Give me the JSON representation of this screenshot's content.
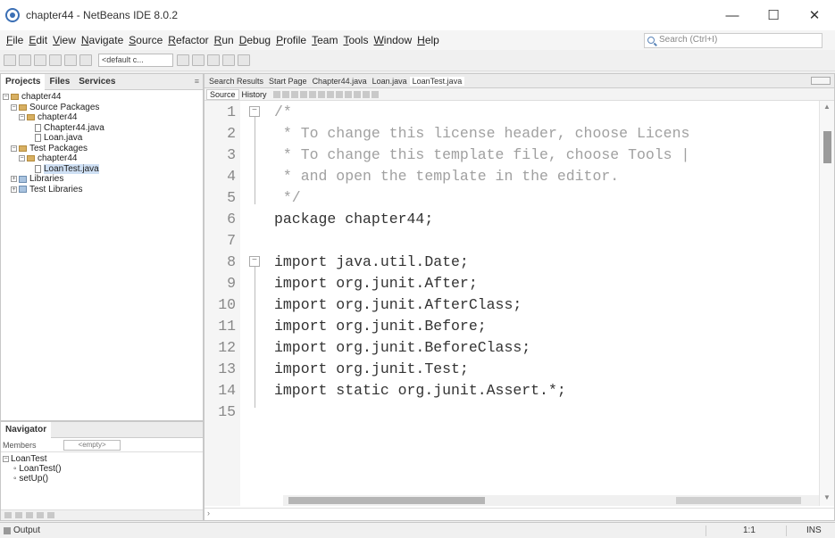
{
  "window": {
    "title": "chapter44 - NetBeans IDE 8.0.2",
    "controls": [
      "—",
      "☐",
      "✕"
    ]
  },
  "menubar": {
    "items": [
      "File",
      "Edit",
      "View",
      "Navigate",
      "Source",
      "Refactor",
      "Run",
      "Debug",
      "Profile",
      "Team",
      "Tools",
      "Window",
      "Help"
    ],
    "search_placeholder": "Search (Ctrl+I)"
  },
  "toolbar": {
    "config": "<default c..."
  },
  "projects": {
    "tabs": [
      "Projects",
      "Files",
      "Services"
    ],
    "tree": [
      {
        "label": "chapter44",
        "level": 0,
        "type": "project"
      },
      {
        "label": "Source Packages",
        "level": 1,
        "type": "folder"
      },
      {
        "label": "chapter44",
        "level": 2,
        "type": "package"
      },
      {
        "label": "Chapter44.java",
        "level": 3,
        "type": "file"
      },
      {
        "label": "Loan.java",
        "level": 3,
        "type": "file"
      },
      {
        "label": "Test Packages",
        "level": 1,
        "type": "folder"
      },
      {
        "label": "chapter44",
        "level": 2,
        "type": "package"
      },
      {
        "label": "LoanTest.java",
        "level": 3,
        "type": "file",
        "selected": true
      },
      {
        "label": "Libraries",
        "level": 1,
        "type": "lib"
      },
      {
        "label": "Test Libraries",
        "level": 1,
        "type": "lib"
      }
    ]
  },
  "navigator": {
    "title": "Navigator",
    "filter_label": "Members",
    "filter_value": "<empty>",
    "tree": [
      "LoanTest",
      "LoanTest()",
      "setUp()"
    ]
  },
  "editor": {
    "tabs": [
      "Search Results",
      "Start Page",
      "Chapter44.java",
      "Loan.java",
      "LoanTest.java"
    ],
    "active_tab": "LoanTest.java",
    "view_tabs": [
      "Source",
      "History"
    ],
    "lines": [
      {
        "n": "1",
        "text": "/*",
        "comment": true
      },
      {
        "n": "2",
        "text": " * To change this license header, choose Licens",
        "comment": true
      },
      {
        "n": "3",
        "text": " * To change this template file, choose Tools |",
        "comment": true
      },
      {
        "n": "4",
        "text": " * and open the template in the editor.",
        "comment": true
      },
      {
        "n": "5",
        "text": " */",
        "comment": true
      },
      {
        "n": "6",
        "text": "package chapter44;",
        "comment": false
      },
      {
        "n": "7",
        "text": "",
        "comment": false
      },
      {
        "n": "8",
        "text": "import java.util.Date;",
        "comment": false
      },
      {
        "n": "9",
        "text": "import org.junit.After;",
        "comment": false
      },
      {
        "n": "10",
        "text": "import org.junit.AfterClass;",
        "comment": false
      },
      {
        "n": "11",
        "text": "import org.junit.Before;",
        "comment": false
      },
      {
        "n": "12",
        "text": "import org.junit.BeforeClass;",
        "comment": false
      },
      {
        "n": "13",
        "text": "import org.junit.Test;",
        "comment": false
      },
      {
        "n": "14",
        "text": "import static org.junit.Assert.*;",
        "comment": false
      },
      {
        "n": "15",
        "text": "",
        "comment": false
      }
    ]
  },
  "statusbar": {
    "output": "Output",
    "position": "1:1",
    "mode": "INS"
  }
}
